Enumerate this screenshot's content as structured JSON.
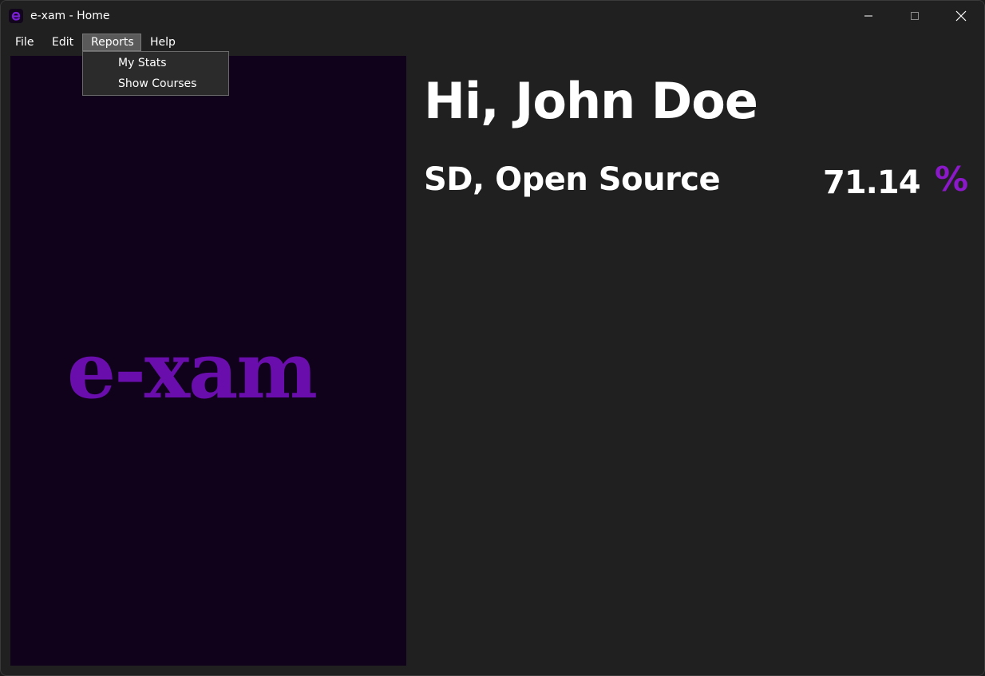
{
  "window": {
    "title": "e-xam - Home",
    "app_icon": "e-xam-app-icon",
    "controls": [
      "minimize-icon",
      "maximize-icon",
      "close-icon"
    ]
  },
  "menu": {
    "items": [
      {
        "label": "File"
      },
      {
        "label": "Edit"
      },
      {
        "label": "Reports",
        "open": true
      },
      {
        "label": "Help"
      }
    ]
  },
  "reports_menu": {
    "items": [
      {
        "label": "My Stats"
      },
      {
        "label": "Show Courses"
      }
    ]
  },
  "brand": {
    "logo_text": "e-xam"
  },
  "main": {
    "greeting": "Hi, John Doe",
    "course": {
      "name": "SD, Open Source",
      "score": "71.14",
      "unit": "%"
    }
  },
  "colors": {
    "accent": "#6a0dad",
    "percent": "#8b18c9",
    "brand_panel_bg": "#11021b",
    "window_bg": "#202020"
  }
}
